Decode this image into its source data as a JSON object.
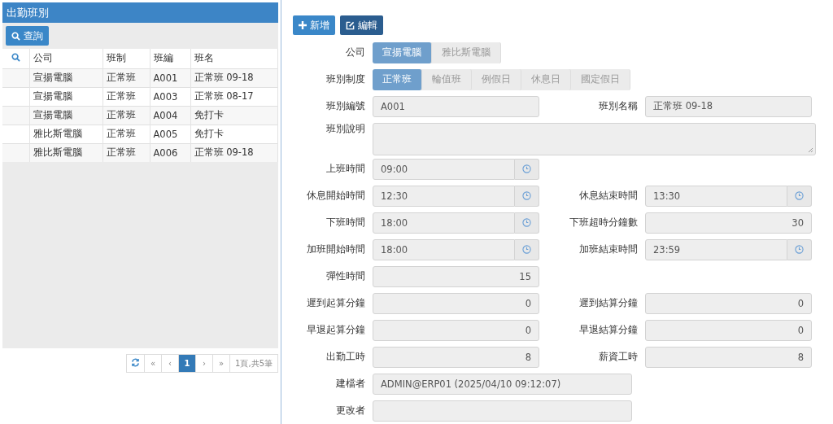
{
  "list_panel": {
    "title": "出勤班別",
    "search_button": "查詢",
    "table": {
      "columns": [
        "公司",
        "班制",
        "班編",
        "班名"
      ],
      "rows": [
        [
          "宣揚電腦",
          "正常班",
          "A001",
          "正常班 09-18"
        ],
        [
          "宣揚電腦",
          "正常班",
          "A003",
          "正常班 08-17"
        ],
        [
          "宣揚電腦",
          "正常班",
          "A004",
          "免打卡"
        ],
        [
          "雅比斯電腦",
          "正常班",
          "A005",
          "免打卡"
        ],
        [
          "雅比斯電腦",
          "正常班",
          "A006",
          "正常班 09-18"
        ]
      ]
    },
    "pagination": {
      "pages": [
        {
          "label": "«",
          "selected": false
        },
        {
          "label": "‹",
          "selected": false
        },
        {
          "label": "1",
          "selected": true
        },
        {
          "label": "›",
          "selected": false
        },
        {
          "label": "»",
          "selected": false
        }
      ],
      "summary": "1頁,共5筆"
    }
  },
  "form": {
    "buttons": [
      {
        "label": "新增",
        "kind": "add"
      },
      {
        "label": "編輯",
        "kind": "edit"
      }
    ],
    "segments": [
      {
        "label": "公司",
        "options": [
          {
            "label": "宣揚電腦",
            "selected": true
          },
          {
            "label": "雅比斯電腦",
            "selected": false
          }
        ]
      },
      {
        "label": "班別制度",
        "options": [
          {
            "label": "正常班",
            "selected": true
          },
          {
            "label": "輪值班",
            "selected": false
          },
          {
            "label": "例假日",
            "selected": false
          },
          {
            "label": "休息日",
            "selected": false
          },
          {
            "label": "國定假日",
            "selected": false
          }
        ]
      }
    ],
    "rows": [
      {
        "fields": [
          {
            "label": "班別編號",
            "value": "A001",
            "kind": "text"
          },
          {
            "label": "班別名稱",
            "value": "正常班 09-18",
            "kind": "text"
          }
        ]
      },
      {
        "fields": [
          {
            "label": "班別說明",
            "kind": "textarea"
          }
        ]
      },
      {
        "fields": [
          {
            "label": "上班時間",
            "value": "09:00",
            "kind": "time"
          }
        ]
      },
      {
        "fields": [
          {
            "label": "休息開始時間",
            "value": "12:30",
            "kind": "time"
          },
          {
            "label": "休息結束時間",
            "value": "13:30",
            "kind": "time"
          }
        ]
      },
      {
        "fields": [
          {
            "label": "下班時間",
            "value": "18:00",
            "kind": "time"
          },
          {
            "label": "下班超時分鐘數",
            "value": "30",
            "kind": "number"
          }
        ]
      },
      {
        "fields": [
          {
            "label": "加班開始時間",
            "value": "18:00",
            "kind": "time"
          },
          {
            "label": "加班結束時間",
            "value": "23:59",
            "kind": "time"
          }
        ]
      },
      {
        "fields": [
          {
            "label": "彈性時間",
            "value": "15",
            "kind": "number"
          }
        ]
      },
      {
        "fields": [
          {
            "label": "遲到起算分鐘",
            "value": "0",
            "kind": "number"
          },
          {
            "label": "遲到結算分鐘",
            "value": "0",
            "kind": "number"
          }
        ]
      },
      {
        "fields": [
          {
            "label": "早退起算分鐘",
            "value": "0",
            "kind": "number"
          },
          {
            "label": "早退結算分鐘",
            "value": "0",
            "kind": "number"
          }
        ]
      },
      {
        "fields": [
          {
            "label": "出勤工時",
            "value": "8",
            "kind": "number"
          },
          {
            "label": "薪資工時",
            "value": "8",
            "kind": "number"
          }
        ]
      },
      {
        "fields": [
          {
            "label": "建檔者",
            "value": "ADMIN@ERP01 (2025/04/10 09:12:07)",
            "kind": "wide"
          }
        ]
      },
      {
        "fields": [
          {
            "label": "更改者",
            "kind": "wide"
          }
        ]
      }
    ]
  }
}
